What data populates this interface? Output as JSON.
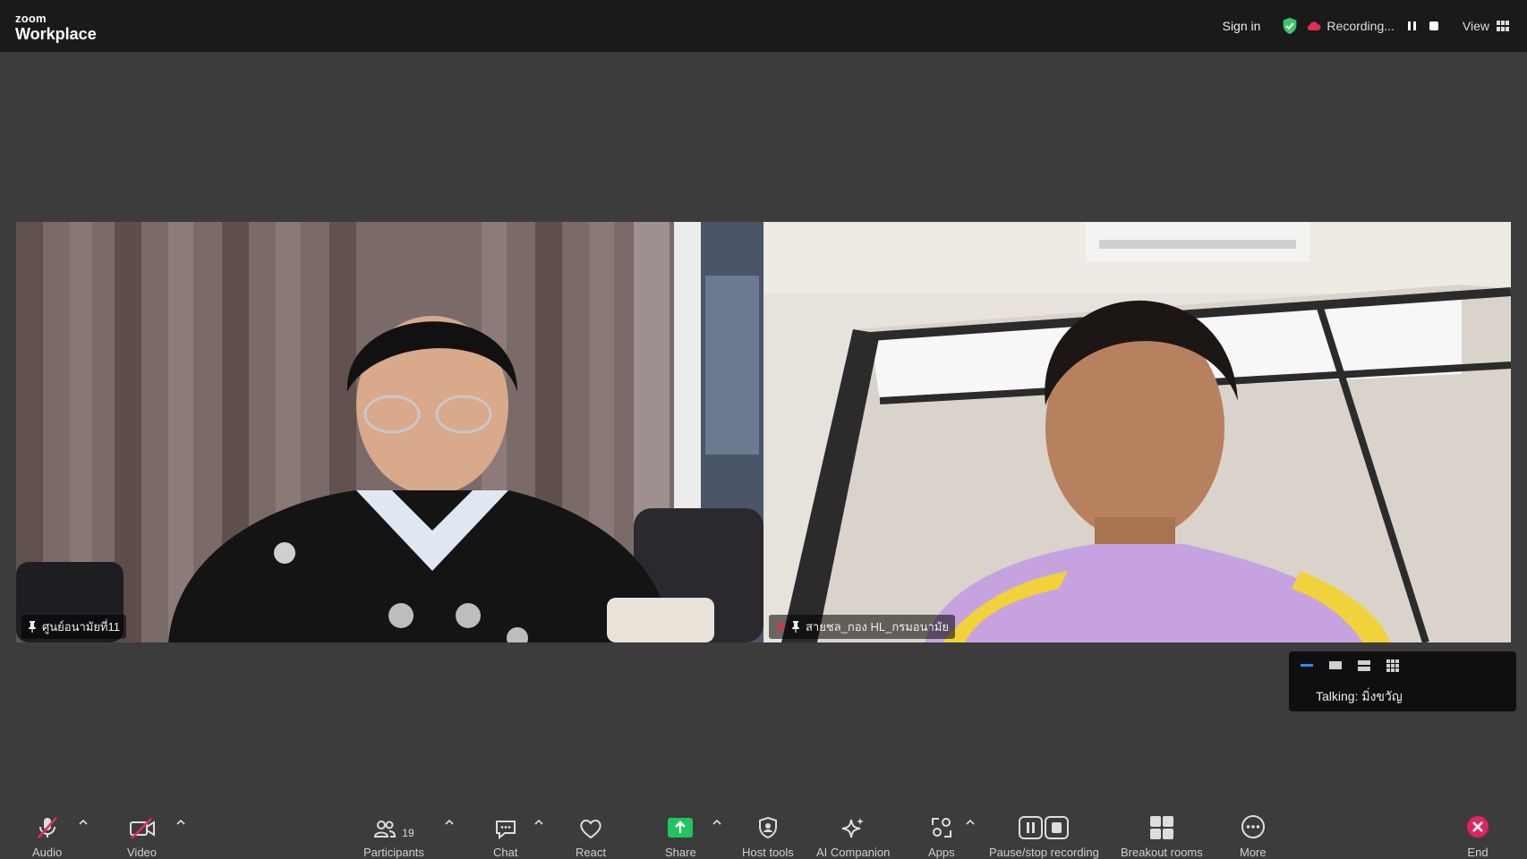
{
  "app": {
    "brand_small": "zoom",
    "brand_big": "Workplace"
  },
  "topbar": {
    "sign_in": "Sign in",
    "recording": "Recording...",
    "view": "View",
    "colors": {
      "shield": "#3ec46d",
      "bg": "#1a1a1a"
    }
  },
  "participants_tiles": [
    {
      "name": "ศูนย์อนามัยที่11",
      "muted": false,
      "pinned": true
    },
    {
      "name": "สายชล_กอง HL_กรมอนามัย",
      "muted": true,
      "pinned": true
    }
  ],
  "talking_panel": {
    "label": "Talking:",
    "speaker": "มิ่งขวัญ"
  },
  "toolbar": {
    "audio": "Audio",
    "video": "Video",
    "participants": "Participants",
    "participants_count": "19",
    "chat": "Chat",
    "react": "React",
    "share": "Share",
    "host_tools": "Host tools",
    "ai_companion": "AI Companion",
    "apps": "Apps",
    "pause_stop": "Pause/stop recording",
    "breakout": "Breakout rooms",
    "more": "More",
    "end": "End",
    "colors": {
      "share_green": "#20c55e",
      "end_red": "#e0245e",
      "muted_red": "#e02f4f"
    }
  }
}
